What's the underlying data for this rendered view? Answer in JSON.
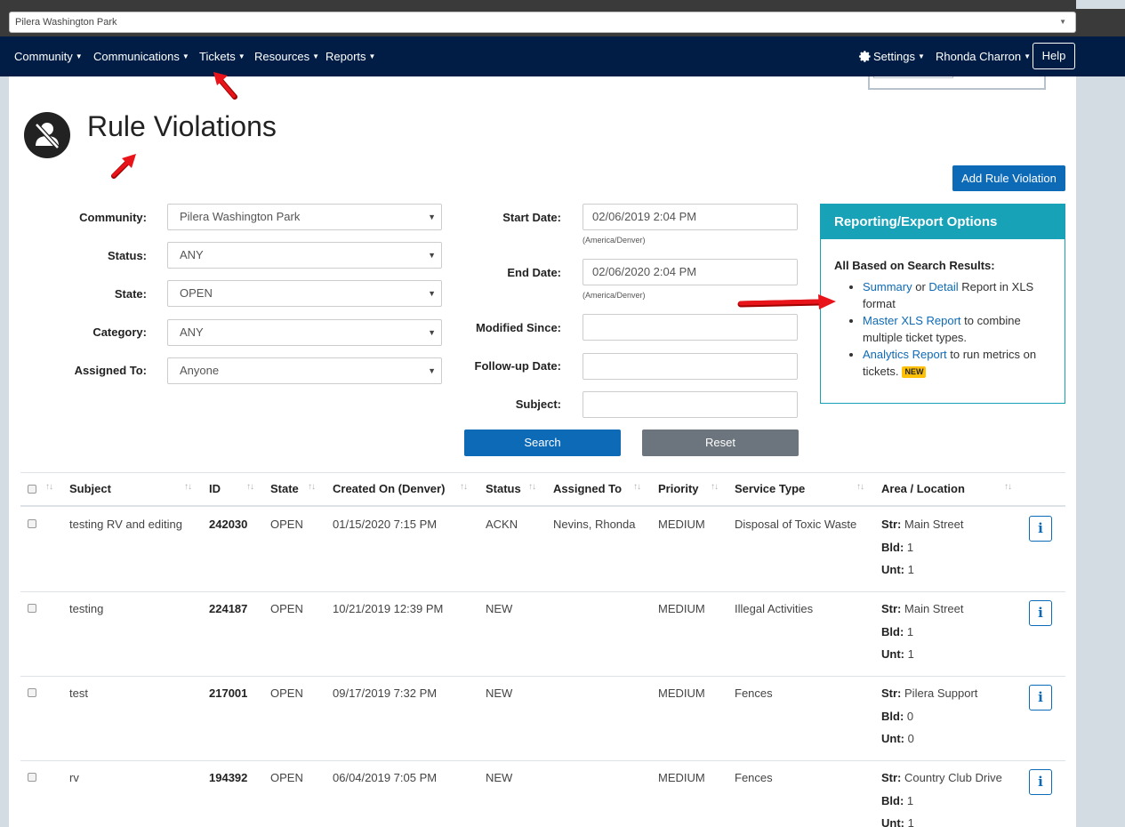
{
  "community_select": {
    "value": "Pilera Washington Park"
  },
  "nav": {
    "community": "Community",
    "communications": "Communications",
    "tickets": "Tickets",
    "resources": "Resources",
    "reports": "Reports",
    "settings": "Settings",
    "user": "Rhonda Charron",
    "help": "Help"
  },
  "page": {
    "title": "Rule Violations",
    "add_button": "Add Rule Violation"
  },
  "filters": {
    "community": {
      "label": "Community:",
      "value": "Pilera Washington Park"
    },
    "status": {
      "label": "Status:",
      "value": "ANY"
    },
    "state": {
      "label": "State:",
      "value": "OPEN"
    },
    "category": {
      "label": "Category:",
      "value": "ANY"
    },
    "assigned_to": {
      "label": "Assigned To:",
      "value": "Anyone"
    },
    "start_date": {
      "label": "Start Date:",
      "value": "02/06/2019 2:04 PM",
      "tz": "(America/Denver)"
    },
    "end_date": {
      "label": "End Date:",
      "value": "02/06/2020 2:04 PM",
      "tz": "(America/Denver)"
    },
    "modified_since": {
      "label": "Modified Since:",
      "value": ""
    },
    "followup_date": {
      "label": "Follow-up Date:",
      "value": ""
    },
    "subject": {
      "label": "Subject:",
      "value": ""
    },
    "search_button": "Search",
    "reset_button": "Reset"
  },
  "report_panel": {
    "title": "Reporting/Export Options",
    "subtitle": "All Based on Search Results:",
    "item1": {
      "link1": "Summary",
      "or": " or ",
      "link2": "Detail",
      "text": " Report in XLS format"
    },
    "item2": {
      "link": "Master XLS Report",
      "text": " to combine multiple ticket types."
    },
    "item3": {
      "link": "Analytics Report",
      "text": " to run metrics on tickets.",
      "badge": "NEW"
    }
  },
  "table": {
    "headers": {
      "subject": "Subject",
      "id": "ID",
      "state": "State",
      "created": "Created On (Denver)",
      "status": "Status",
      "assigned": "Assigned To",
      "priority": "Priority",
      "service": "Service Type",
      "area": "Area / Location"
    },
    "loc_labels": {
      "str": "Str:",
      "bld": "Bld:",
      "unt": "Unt:"
    },
    "info_glyph": "i",
    "rows": [
      {
        "subject": "testing RV and editing",
        "id": "242030",
        "state": "OPEN",
        "created": "01/15/2020 7:15 PM",
        "status": "ACKN",
        "assigned": "Nevins, Rhonda",
        "priority": "MEDIUM",
        "service": "Disposal of Toxic Waste",
        "str": "Main Street",
        "bld": "1",
        "unt": "1"
      },
      {
        "subject": "testing",
        "id": "224187",
        "state": "OPEN",
        "created": "10/21/2019 12:39 PM",
        "status": "NEW",
        "assigned": "",
        "priority": "MEDIUM",
        "service": "Illegal Activities",
        "str": "Main Street",
        "bld": "1",
        "unt": "1"
      },
      {
        "subject": "test",
        "id": "217001",
        "state": "OPEN",
        "created": "09/17/2019 7:32 PM",
        "status": "NEW",
        "assigned": "",
        "priority": "MEDIUM",
        "service": "Fences",
        "str": "Pilera Support",
        "bld": "0",
        "unt": "0"
      },
      {
        "subject": "rv",
        "id": "194392",
        "state": "OPEN",
        "created": "06/04/2019 7:05 PM",
        "status": "NEW",
        "assigned": "",
        "priority": "MEDIUM",
        "service": "Fences",
        "str": "Country Club Drive",
        "bld": "1",
        "unt": "1"
      }
    ]
  },
  "colors": {
    "navbar": "#011d45",
    "primary": "#0d6ab6",
    "panel": "#17a2b8",
    "annotation_arrow": "#e8141a"
  }
}
